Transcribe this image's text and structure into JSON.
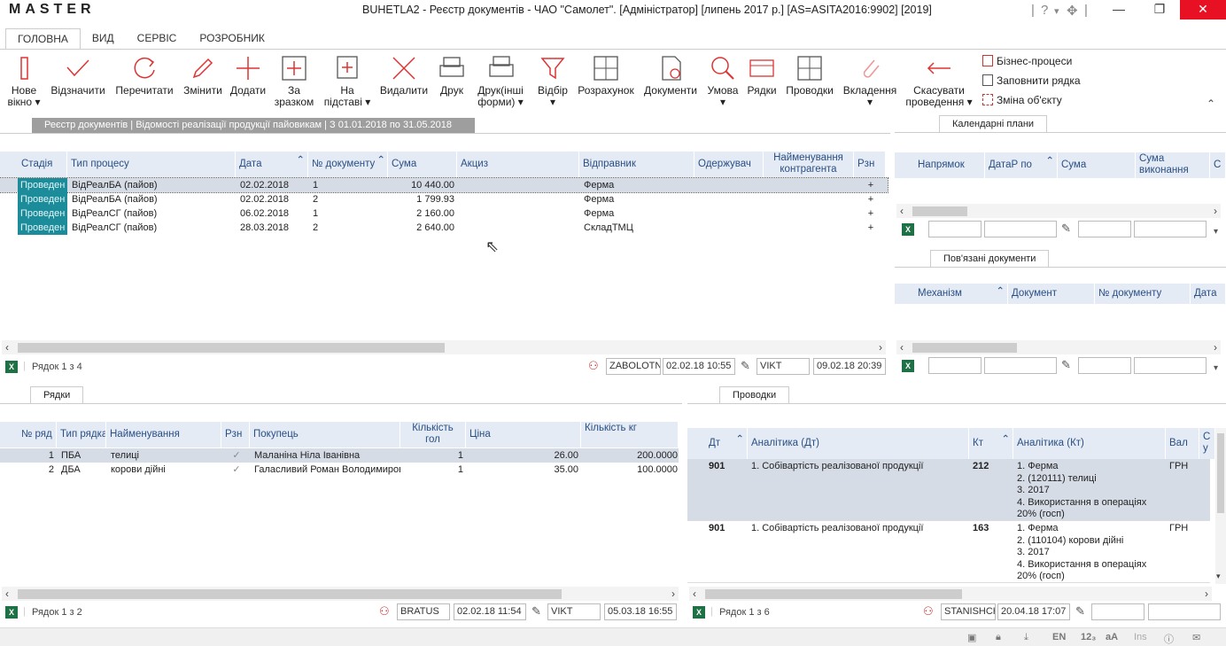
{
  "app": {
    "logo": "MASTER",
    "window_title": "BUHETLA2 - Реєстр документів - ЧАО \"Самолет\". [Адміністратор] [липень 2017 р.] [AS=ASITA2016:9902] [2019]"
  },
  "menu_tabs": [
    "ГОЛОВНА",
    "ВИД",
    "СЕРВІС",
    "РОЗРОБНИК"
  ],
  "ribbon": {
    "new_window": "Нове\nвікно ▾",
    "mark": "Відзначити",
    "reread": "Перечитати",
    "edit": "Змінити",
    "add": "Додати",
    "by_sample": "За\nзразком",
    "on_basis": "На\nпідставі ▾",
    "delete": "Видалити",
    "print": "Друк",
    "print_other": "Друк(інші\nформи) ▾",
    "filter": "Відбір\n▾",
    "calculation": "Розрахунок",
    "documents": "Документи",
    "condition": "Умова\n▾",
    "rows": "Рядки",
    "postings": "Проводки",
    "attachments": "Вкладення\n▾",
    "cancel_posting": "Скасувати\nпроведення ▾",
    "business_processes": "Бізнес-процеси",
    "fill_row": "Заповнити рядка",
    "change_object": "Зміна об'єкту"
  },
  "breadcrumb": "Реєстр документів | Відомості реалізації продукції пайовикам | З 01.01.2018 по 31.05.2018",
  "main_grid": {
    "headers": [
      "Стадія",
      "Тип процесу",
      "Дата",
      "№ документу",
      "Сума",
      "Акциз",
      "Відправник",
      "Одержувач",
      "Найменування контрагента",
      "Рзн"
    ],
    "rows": [
      [
        "Проведен",
        "ВідРеалБА (пайов)",
        "02.02.2018",
        "1",
        "10 440.00",
        "",
        "Ферма",
        "",
        "",
        "+"
      ],
      [
        "Проведен",
        "ВідРеалБА (пайов)",
        "02.02.2018",
        "2",
        "1 799.93",
        "",
        "Ферма",
        "",
        "",
        "+"
      ],
      [
        "Проведен",
        "ВідРеалСГ (пайов)",
        "06.02.2018",
        "1",
        "2 160.00",
        "",
        "Ферма",
        "",
        "",
        "+"
      ],
      [
        "Проведен",
        "ВідРеалСГ (пайов)",
        "28.03.2018",
        "2",
        "2 640.00",
        "",
        "СкладТМЦ",
        "",
        "",
        "+"
      ]
    ],
    "footer": {
      "rowinfo": "Рядок 1 з 4",
      "created_by": "ZABOLOTN",
      "created_at": "02.02.18 10:55",
      "modified_by": "VIKT",
      "modified_at": "09.02.18 20:39"
    }
  },
  "calendar": {
    "tab": "Календарні плани",
    "headers": [
      "Напрямок",
      "ДатаР по",
      "Сума",
      "Сума виконання",
      "С"
    ]
  },
  "linked": {
    "tab": "Пов'язані документи",
    "headers": [
      "Механізм",
      "Документ",
      "№ документу",
      "Дата"
    ]
  },
  "rows_panel": {
    "tab": "Рядки",
    "headers": [
      "№ ряд",
      "Тип рядка",
      "Найменування",
      "Рзн",
      "Покупець",
      "Кількість гол",
      "Ціна",
      "Кількість кг"
    ],
    "rows": [
      [
        "1",
        "ПБА",
        "телиці",
        "✓",
        "Маланіна Ніла Іванівна",
        "1",
        "26.00",
        "200.0000"
      ],
      [
        "2",
        "ДБА",
        "корови дійні",
        "✓",
        "Галасливий Роман Володимиров",
        "1",
        "35.00",
        "100.0000"
      ]
    ],
    "footer": {
      "rowinfo": "Рядок 1 з 2",
      "created_by": "BRATUS",
      "created_at": "02.02.18 11:54",
      "modified_by": "VIKT",
      "modified_at": "05.03.18 16:55"
    }
  },
  "postings_panel": {
    "tab": "Проводки",
    "headers": [
      "Дт",
      "Аналітика (Дт)",
      "Кт",
      "Аналітика (Кт)",
      "Вал",
      "С у"
    ],
    "rows": [
      {
        "dt": "901",
        "an_dt": "1. Собівартість реалізованої продукції",
        "kt": "212",
        "an_kt": "1. Ферма\n2. (120111) телиці\n3. 2017\n4. Використання в операціях 20% (госп)",
        "cur": "ГРН"
      },
      {
        "dt": "901",
        "an_dt": "1. Собівартість реалізованої продукції",
        "kt": "163",
        "an_kt": "1. Ферма\n2. (110104) корови дійні\n3. 2017\n4. Використання в операціях 20% (госп)",
        "cur": "ГРН"
      }
    ],
    "footer": {
      "rowinfo": "Рядок 1 з 6",
      "created_by": "STANISHCH",
      "created_at": "20.04.18 17:07"
    }
  },
  "status": {
    "lang": "EN",
    "num": "12₃",
    "ins": "Ins"
  },
  "colors": {
    "stage": "#1c8c9a",
    "header_bg": "#e4ebf5",
    "accent_red": "#c33"
  }
}
